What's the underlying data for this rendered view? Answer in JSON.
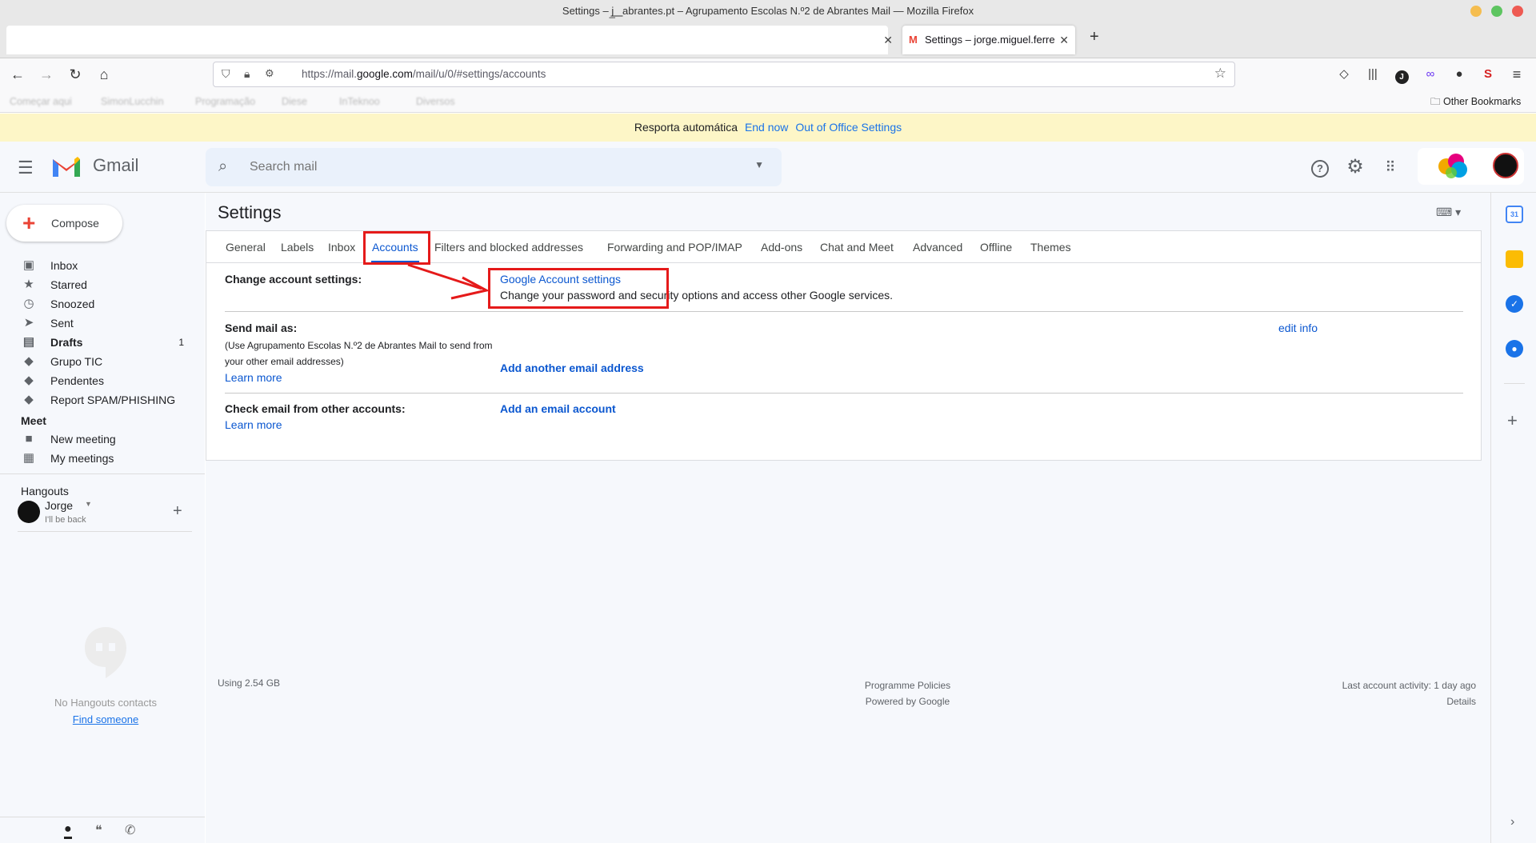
{
  "browser": {
    "window_title": "Settings – j̲̲̲  ̲̲̲̲̲̲̲ ̲̲̲̲̲̲̲  abrantes.pt – Agrupamento Escolas N.º2 de Abrantes Mail — Mozilla Firefox",
    "tabs": [
      {
        "label": ""
      },
      {
        "label": "Settings – jorge.miguel.ferre"
      }
    ],
    "url_prefix": "https://mail.",
    "url_domain": "google.com",
    "url_suffix": "/mail/u/0/#settings/accounts",
    "bookmarks": [
      "Começar aqui",
      "SimonLucchin",
      "Programação",
      "Diese",
      "InTeknoo",
      "Diversos",
      "Other Bookmarks"
    ]
  },
  "ooo_banner": {
    "text": "Resporta automática",
    "end_now": "End now",
    "settings_link": "Out of Office Settings"
  },
  "header": {
    "brand": "Gmail",
    "search_placeholder": "Search mail"
  },
  "sidebar": {
    "compose": "Compose",
    "items": [
      {
        "label": "Inbox",
        "icon": "inbox-icon",
        "count": ""
      },
      {
        "label": "Starred",
        "icon": "star-icon",
        "count": ""
      },
      {
        "label": "Snoozed",
        "icon": "clock-icon",
        "count": ""
      },
      {
        "label": "Sent",
        "icon": "send-icon",
        "count": ""
      },
      {
        "label": "Drafts",
        "icon": "draft-icon",
        "count": "1"
      },
      {
        "label": "Grupo TIC",
        "icon": "label-icon",
        "count": ""
      },
      {
        "label": "Pendentes",
        "icon": "label-icon",
        "count": ""
      },
      {
        "label": "Report SPAM/PHISHING",
        "icon": "label-icon",
        "count": ""
      }
    ],
    "meet_title": "Meet",
    "meet_items": [
      {
        "label": "New meeting",
        "icon": "video-icon"
      },
      {
        "label": "My meetings",
        "icon": "calendar-icon"
      }
    ],
    "hangouts_title": "Hangouts",
    "hangouts_user": "Jorge",
    "hangouts_status": "I'll be back",
    "no_contacts": "No Hangouts contacts",
    "find_someone": "Find someone"
  },
  "settings": {
    "title": "Settings",
    "tabs": [
      "General",
      "Labels",
      "Inbox",
      "Accounts",
      "Filters and blocked addresses",
      "Forwarding and POP/IMAP",
      "Add-ons",
      "Chat and Meet",
      "Advanced",
      "Offline",
      "Themes"
    ],
    "active_tab": "Accounts",
    "change_account": {
      "label": "Change account settings:",
      "link": "Google Account settings",
      "description": "Change your password and security options and access other Google services."
    },
    "send_mail_as": {
      "label": "Send mail as:",
      "sub": "(Use Agrupamento Escolas N.º2 de Abrantes Mail to send from your other email addresses)",
      "learn_more": "Learn more",
      "edit_info": "edit info",
      "add_address": "Add another email address"
    },
    "check_email": {
      "label": "Check email from other accounts:",
      "learn_more": "Learn more",
      "add_account": "Add an email account"
    }
  },
  "footer": {
    "storage": "Using 2.54 GB",
    "policies": "Programme Policies",
    "powered": "Powered by Google",
    "activity": "Last account activity: 1 day ago",
    "details": "Details"
  },
  "colors": {
    "accent": "#0b57d0",
    "annotation": "#e51a1a",
    "banner": "#fdf6c7"
  }
}
